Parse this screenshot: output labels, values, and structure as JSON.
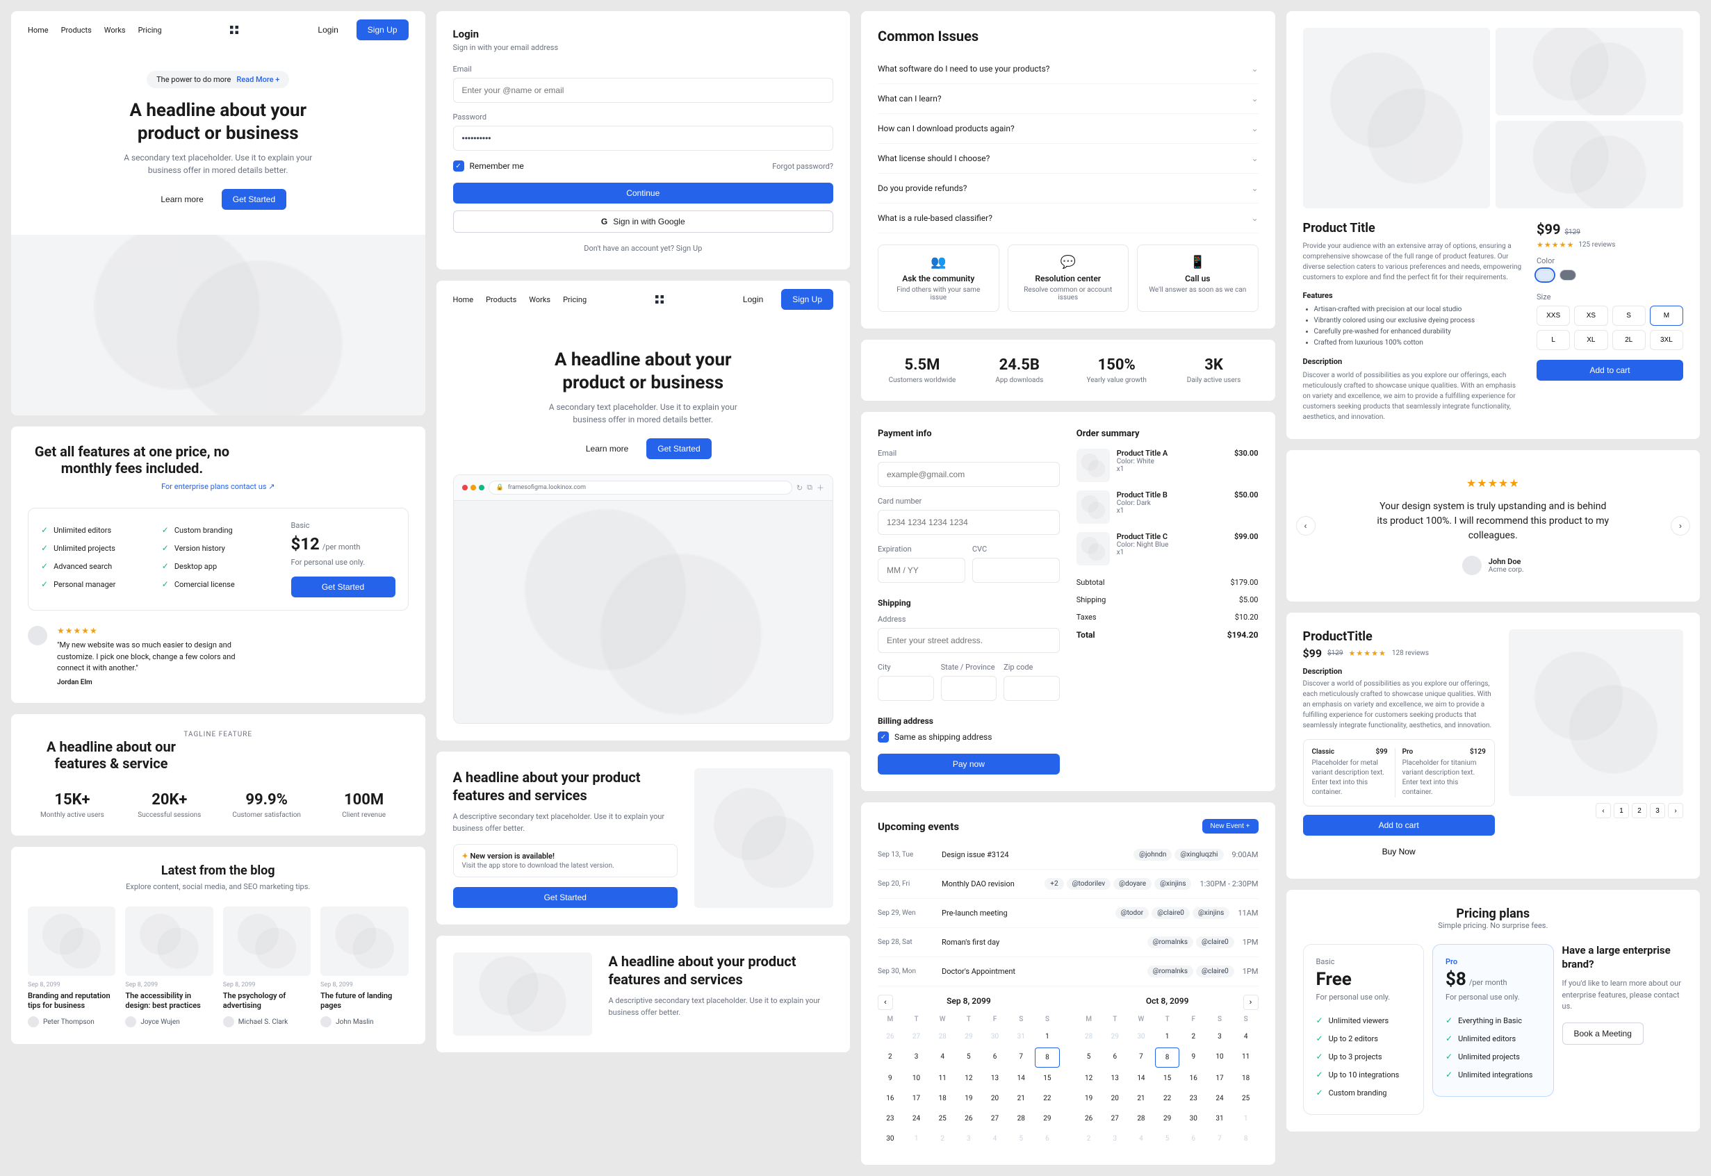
{
  "nav": {
    "home": "Home",
    "products": "Products",
    "works": "Works",
    "pricing": "Pricing",
    "login": "Login",
    "signup": "Sign Up"
  },
  "hero1": {
    "pill": "The power to do more",
    "pill_more": "Read More +",
    "headline": "A headline about your product or business",
    "sub": "A secondary text placeholder. Use it to explain your business offer in mored details better.",
    "learn": "Learn more",
    "cta": "Get Started"
  },
  "pricing1": {
    "title": "Get all features at one price, no monthly fees included.",
    "enterprise": "For enterprise plans contact us ↗",
    "features": [
      "Unlimited editors",
      "Unlimited projects",
      "Advanced search",
      "Personal manager",
      "Custom branding",
      "Version history",
      "Desktop app",
      "Comercial license"
    ],
    "plan": "Basic",
    "price": "$12",
    "per": "/per month",
    "note": "For personal use only.",
    "cta": "Get Started",
    "testimonial": "\"My new website was so much easier to design and customize. I pick one block, change a few colors and connect it with another.\"",
    "author": "Jordan Elm"
  },
  "tagline": {
    "tag": "TAGLINE FEATURE",
    "title": "A headline about our features & service",
    "stats": [
      {
        "v": "15K+",
        "l": "Monthly active users"
      },
      {
        "v": "20K+",
        "l": "Successful sessions"
      },
      {
        "v": "99.9%",
        "l": "Customer satisfaction"
      },
      {
        "v": "100M",
        "l": "Client revenue"
      }
    ]
  },
  "blog": {
    "title": "Latest from the blog",
    "sub": "Explore content, social media, and SEO marketing tips.",
    "posts": [
      {
        "d": "Sep 8, 2099",
        "t": "Branding and reputation tips for business",
        "a": "Peter Thompson"
      },
      {
        "d": "Sep 8, 2099",
        "t": "The accessibility in design: best practices",
        "a": "Joyce Wujen"
      },
      {
        "d": "Sep 8, 2099",
        "t": "The psychology of advertising",
        "a": "Michael S. Clark"
      },
      {
        "d": "Sep 8, 2099",
        "t": "The future of landing pages",
        "a": "John Maslin"
      }
    ]
  },
  "login": {
    "title": "Login",
    "sub": "Sign in with your email address",
    "email": "Email",
    "email_ph": "Enter your @name or email",
    "pass": "Password",
    "pass_val": "••••••••••",
    "remember": "Remember me",
    "forgot": "Forgot password?",
    "continue": "Continue",
    "google": "Sign in with Google",
    "noacct": "Don't have an account yet? Sign Up"
  },
  "hero2": {
    "headline": "A headline about your product or business",
    "sub": "A secondary text placeholder. Use it to explain your business offer in mored details better.",
    "learn": "Learn more",
    "cta": "Get Started",
    "url": "framesofigma.lookinox.com"
  },
  "feature": {
    "headline": "A headline about your product features and services",
    "sub": "A descriptive secondary text placeholder. Use it to explain your business offer better.",
    "notice_t": "New version is available!",
    "notice_s": "Visit the app store to download the latest version.",
    "cta": "Get Started"
  },
  "feature2": {
    "headline": "A headline about your product features and services",
    "sub": "A descriptive secondary text placeholder. Use it to explain your business offer better."
  },
  "issues": {
    "title": "Common Issues",
    "qs": [
      "What software do I need to use your products?",
      "What can I learn?",
      "How can I download products again?",
      "What license should I choose?",
      "Do you provide refunds?",
      "What is a rule-based classifier?"
    ],
    "help": [
      {
        "t": "Ask the community",
        "s": "Find others with your same issue"
      },
      {
        "t": "Resolution center",
        "s": "Resolve common or account issues"
      },
      {
        "t": "Call us",
        "s": "We'll answer as soon as we can"
      }
    ]
  },
  "bigstats": [
    {
      "v": "5.5M",
      "l": "Customers worldwide"
    },
    {
      "v": "24.5B",
      "l": "App downloads"
    },
    {
      "v": "150%",
      "l": "Yearly value growth"
    },
    {
      "v": "3K",
      "l": "Daily active users"
    }
  ],
  "payment": {
    "title": "Payment info",
    "email": "Email",
    "email_ph": "example@gmail.com",
    "card": "Card number",
    "card_ph": "1234 1234 1234 1234",
    "exp": "Expiration",
    "exp_ph": "MM / YY",
    "cvc": "CVC",
    "ship": "Shipping",
    "addr": "Address",
    "addr_ph": "Enter your street address.",
    "city": "City",
    "state": "State / Province",
    "zip": "Zip code",
    "bill": "Billing address",
    "same": "Same as shipping address",
    "pay": "Pay now"
  },
  "order": {
    "title": "Order summary",
    "items": [
      {
        "t": "Product Title A",
        "m": "Color: White",
        "q": "x1",
        "p": "$30.00"
      },
      {
        "t": "Product Title B",
        "m": "Color: Dark",
        "q": "x1",
        "p": "$50.00"
      },
      {
        "t": "Product Title C",
        "m": "Color:  Night Blue",
        "q": "x1",
        "p": "$99.00"
      }
    ],
    "totals": [
      {
        "l": "Subtotal",
        "v": "$179.00"
      },
      {
        "l": "Shipping",
        "v": "$5.00"
      },
      {
        "l": "Taxes",
        "v": "$10.20"
      },
      {
        "l": "Total",
        "v": "$194.20"
      }
    ]
  },
  "events": {
    "title": "Upcoming events",
    "new": "New Event +",
    "list": [
      {
        "d": "Sep 13, Tue",
        "t": "Design issue #3124",
        "tags": [
          "@johndn",
          "@xingluqzhi"
        ],
        "time": "9:00AM"
      },
      {
        "d": "Sep 20, Fri",
        "t": "Monthly DAO revision",
        "extra": "+2",
        "tags": [
          "@todorilev",
          "@doyare",
          "@xinjins"
        ],
        "time": "1:30PM - 2:30PM"
      },
      {
        "d": "Sep 29, Wen",
        "t": "Pre-launch meeting",
        "tags": [
          "@todor",
          "@claire0",
          "@xinjins"
        ],
        "time": "11AM"
      },
      {
        "d": "Sep 28, Sat",
        "t": "Roman's first day",
        "tags": [
          "@romalnks",
          "@claire0"
        ],
        "time": "1PM"
      },
      {
        "d": "Sep 30, Mon",
        "t": "Doctor's Appointment",
        "tags": [
          "@romalnks",
          "@claire0"
        ],
        "time": "1PM"
      }
    ],
    "month1": "Sep 8, 2099",
    "month2": "Oct 8, 2099",
    "dow": [
      "M",
      "T",
      "W",
      "T",
      "F",
      "S",
      "S"
    ]
  },
  "product1": {
    "title": "Product Title",
    "price": "$99",
    "old": "$129",
    "reviews": "125 reviews",
    "desc_short": "Provide your audience with an extensive array of options, ensuring a comprehensive showcase of the full range of product features. Our diverse selection caters to various preferences and needs, empowering customers to explore and find the perfect fit for their requirements.",
    "features_label": "Features",
    "features": [
      "Artisan-crafted with precision at our local studio",
      "Vibrantly colored using our exclusive dyeing process",
      "Carefully pre-washed for enhanced durability",
      "Crafted from luxurious 100% cotton"
    ],
    "desc_label": "Description",
    "desc": "Discover a world of possibilities as you explore our offerings, each meticulously crafted to showcase unique qualities. With an emphasis on variety and excellence, we aim to provide a fulfilling experience for customers seeking products that seamlessly integrate functionality, aesthetics, and innovation.",
    "color": "Color",
    "size": "Size",
    "sizes": [
      "XXS",
      "XS",
      "S",
      "M",
      "L",
      "XL",
      "2L",
      "3XL"
    ],
    "add": "Add to cart"
  },
  "testimonial": {
    "text": "Your design system is truly upstanding and is behind its product 100%. I will recommend this product to my colleagues.",
    "author": "John Doe",
    "company": "Acme corp."
  },
  "product2": {
    "title": "ProductTitle",
    "price": "$99",
    "old": "$129",
    "reviews": "128 reviews",
    "desc_label": "Description",
    "desc": "Discover a world of possibilities as you explore our offerings, each meticulously crafted to showcase unique qualities. With an emphasis on variety and excellence, we aim to provide a fulfilling experience for customers seeking products that seamlessly integrate functionality, aesthetics, and innovation.",
    "v1_name": "Classic",
    "v1_price": "$99",
    "v1_desc": "Placeholder for metal variant description text. Enter text into this container.",
    "v2_name": "Pro",
    "v2_price": "$129",
    "v2_desc": "Placeholder for titanium variant description text. Enter text into this container.",
    "add": "Add to cart",
    "buy": "Buy Now"
  },
  "pricing2": {
    "title": "Pricing plans",
    "sub": "Simple pricing. No surprise fees.",
    "basic_name": "Basic",
    "basic_price": "Free",
    "basic_note": "For personal use only.",
    "basic_feat": [
      "Unlimited viewers",
      "Up to 2 editors",
      "Up to 3 projects",
      "Up to 10 integrations",
      "Custom branding"
    ],
    "pro_name": "Pro",
    "pro_price": "$8",
    "pro_per": "/per month",
    "pro_note": "For personal use only.",
    "pro_feat": [
      "Everything in Basic",
      "Unlimited editors",
      "Unlimited projects",
      "Unlimited integrations"
    ],
    "ent_title": "Have a large enterprise brand?",
    "ent_sub": "If you'd like to learn more about our enterprise features, please contact us.",
    "ent_cta": "Book a Meeting"
  }
}
